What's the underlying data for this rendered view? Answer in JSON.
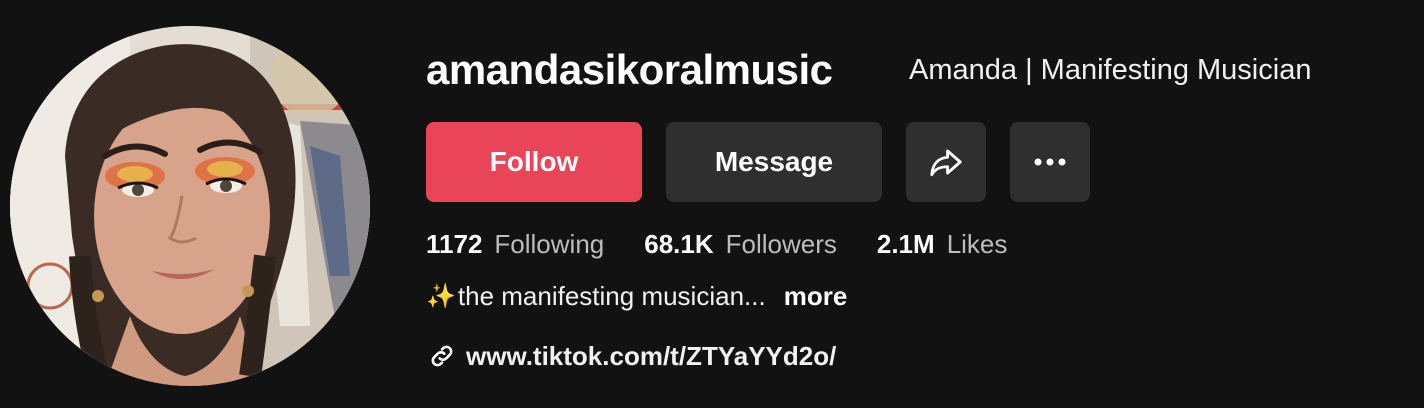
{
  "profile": {
    "username": "amandasikoralmusic",
    "nickname": "Amanda | Manifesting Musician",
    "avatar_icon": "profile-photo"
  },
  "actions": {
    "follow_label": "Follow",
    "message_label": "Message",
    "share_icon": "share-arrow-icon",
    "more_icon": "more-dots-icon"
  },
  "stats": {
    "following": {
      "value": "1172",
      "label": "Following"
    },
    "followers": {
      "value": "68.1K",
      "label": "Followers"
    },
    "likes": {
      "value": "2.1M",
      "label": "Likes"
    }
  },
  "bio": {
    "emoji": "✨",
    "text": "the manifesting musician...",
    "more_label": "more"
  },
  "link": {
    "icon": "link-icon",
    "url": "www.tiktok.com/t/ZTYaYYd2o/"
  },
  "colors": {
    "background": "#121212",
    "follow_button": "#ea4459",
    "secondary_button": "#2f2f2f",
    "muted_text": "#bdbdbd"
  }
}
